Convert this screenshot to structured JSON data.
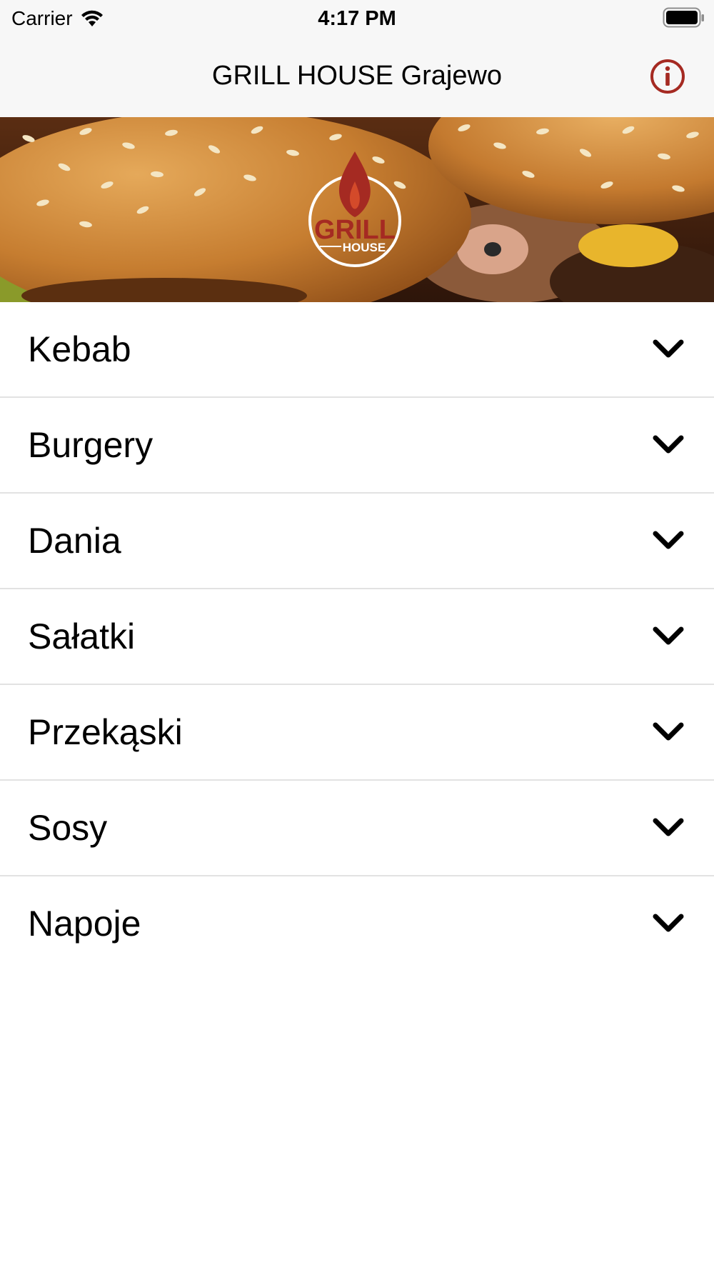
{
  "status_bar": {
    "carrier": "Carrier",
    "time": "4:17 PM",
    "icons": [
      "wifi-icon",
      "battery-icon"
    ]
  },
  "nav": {
    "title": "GRILL HOUSE Grajewo",
    "info_icon": "info-circle-icon",
    "accent_color": "#a52a22"
  },
  "hero": {
    "logo_text_top": "GRILL",
    "logo_text_bottom": "HOUSE",
    "logo_icon": "flame-icon"
  },
  "categories": [
    {
      "label": "Kebab"
    },
    {
      "label": "Burgery"
    },
    {
      "label": "Dania"
    },
    {
      "label": "Sałatki"
    },
    {
      "label": "Przekąski"
    },
    {
      "label": "Sosy"
    },
    {
      "label": "Napoje"
    }
  ],
  "chevron_icon": "chevron-down-icon"
}
